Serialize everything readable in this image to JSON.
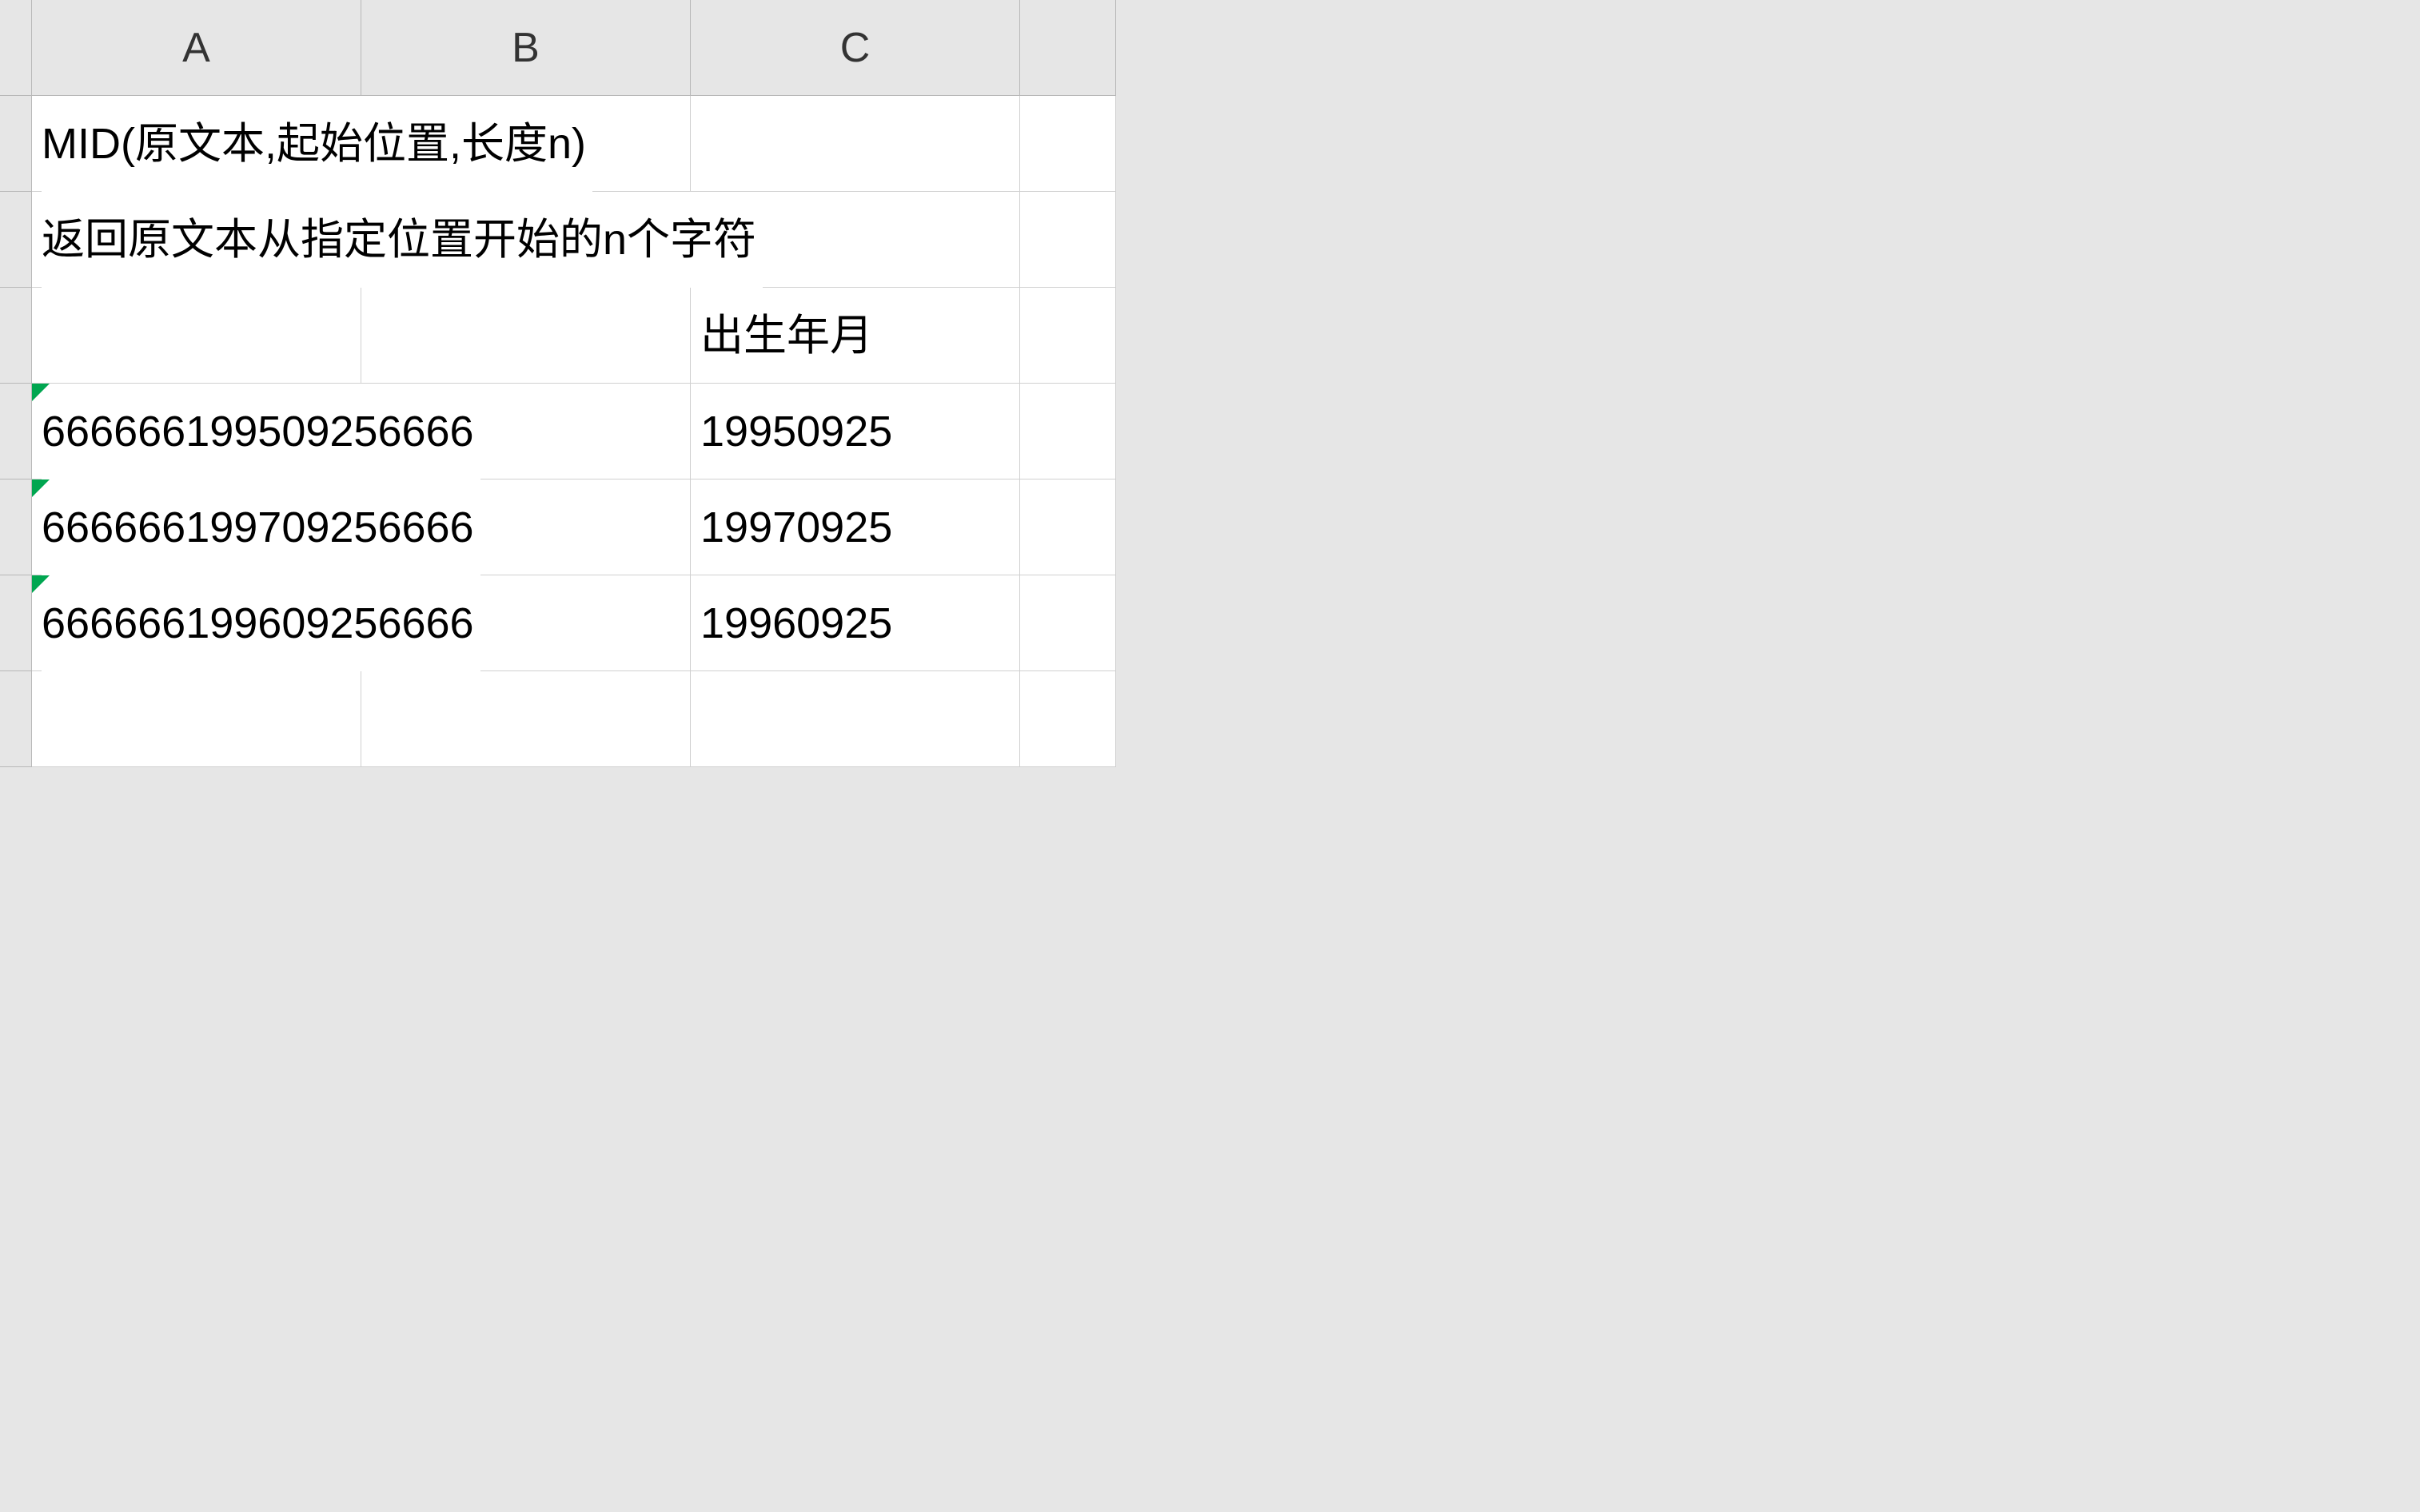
{
  "columns": {
    "A": "A",
    "B": "B",
    "C": "C"
  },
  "rows": {
    "r1": {
      "A": "MID(原文本,起始位置,长度n)"
    },
    "r2": {
      "A": "返回原文本从指定位置开始的n个字符"
    },
    "r3": {
      "C": "出生年月"
    },
    "r4": {
      "A": "666666199509256666",
      "C": "19950925"
    },
    "r5": {
      "A": "666666199709256666",
      "C": "19970925"
    },
    "r6": {
      "A": "666666199609256666",
      "C": "19960925"
    }
  }
}
